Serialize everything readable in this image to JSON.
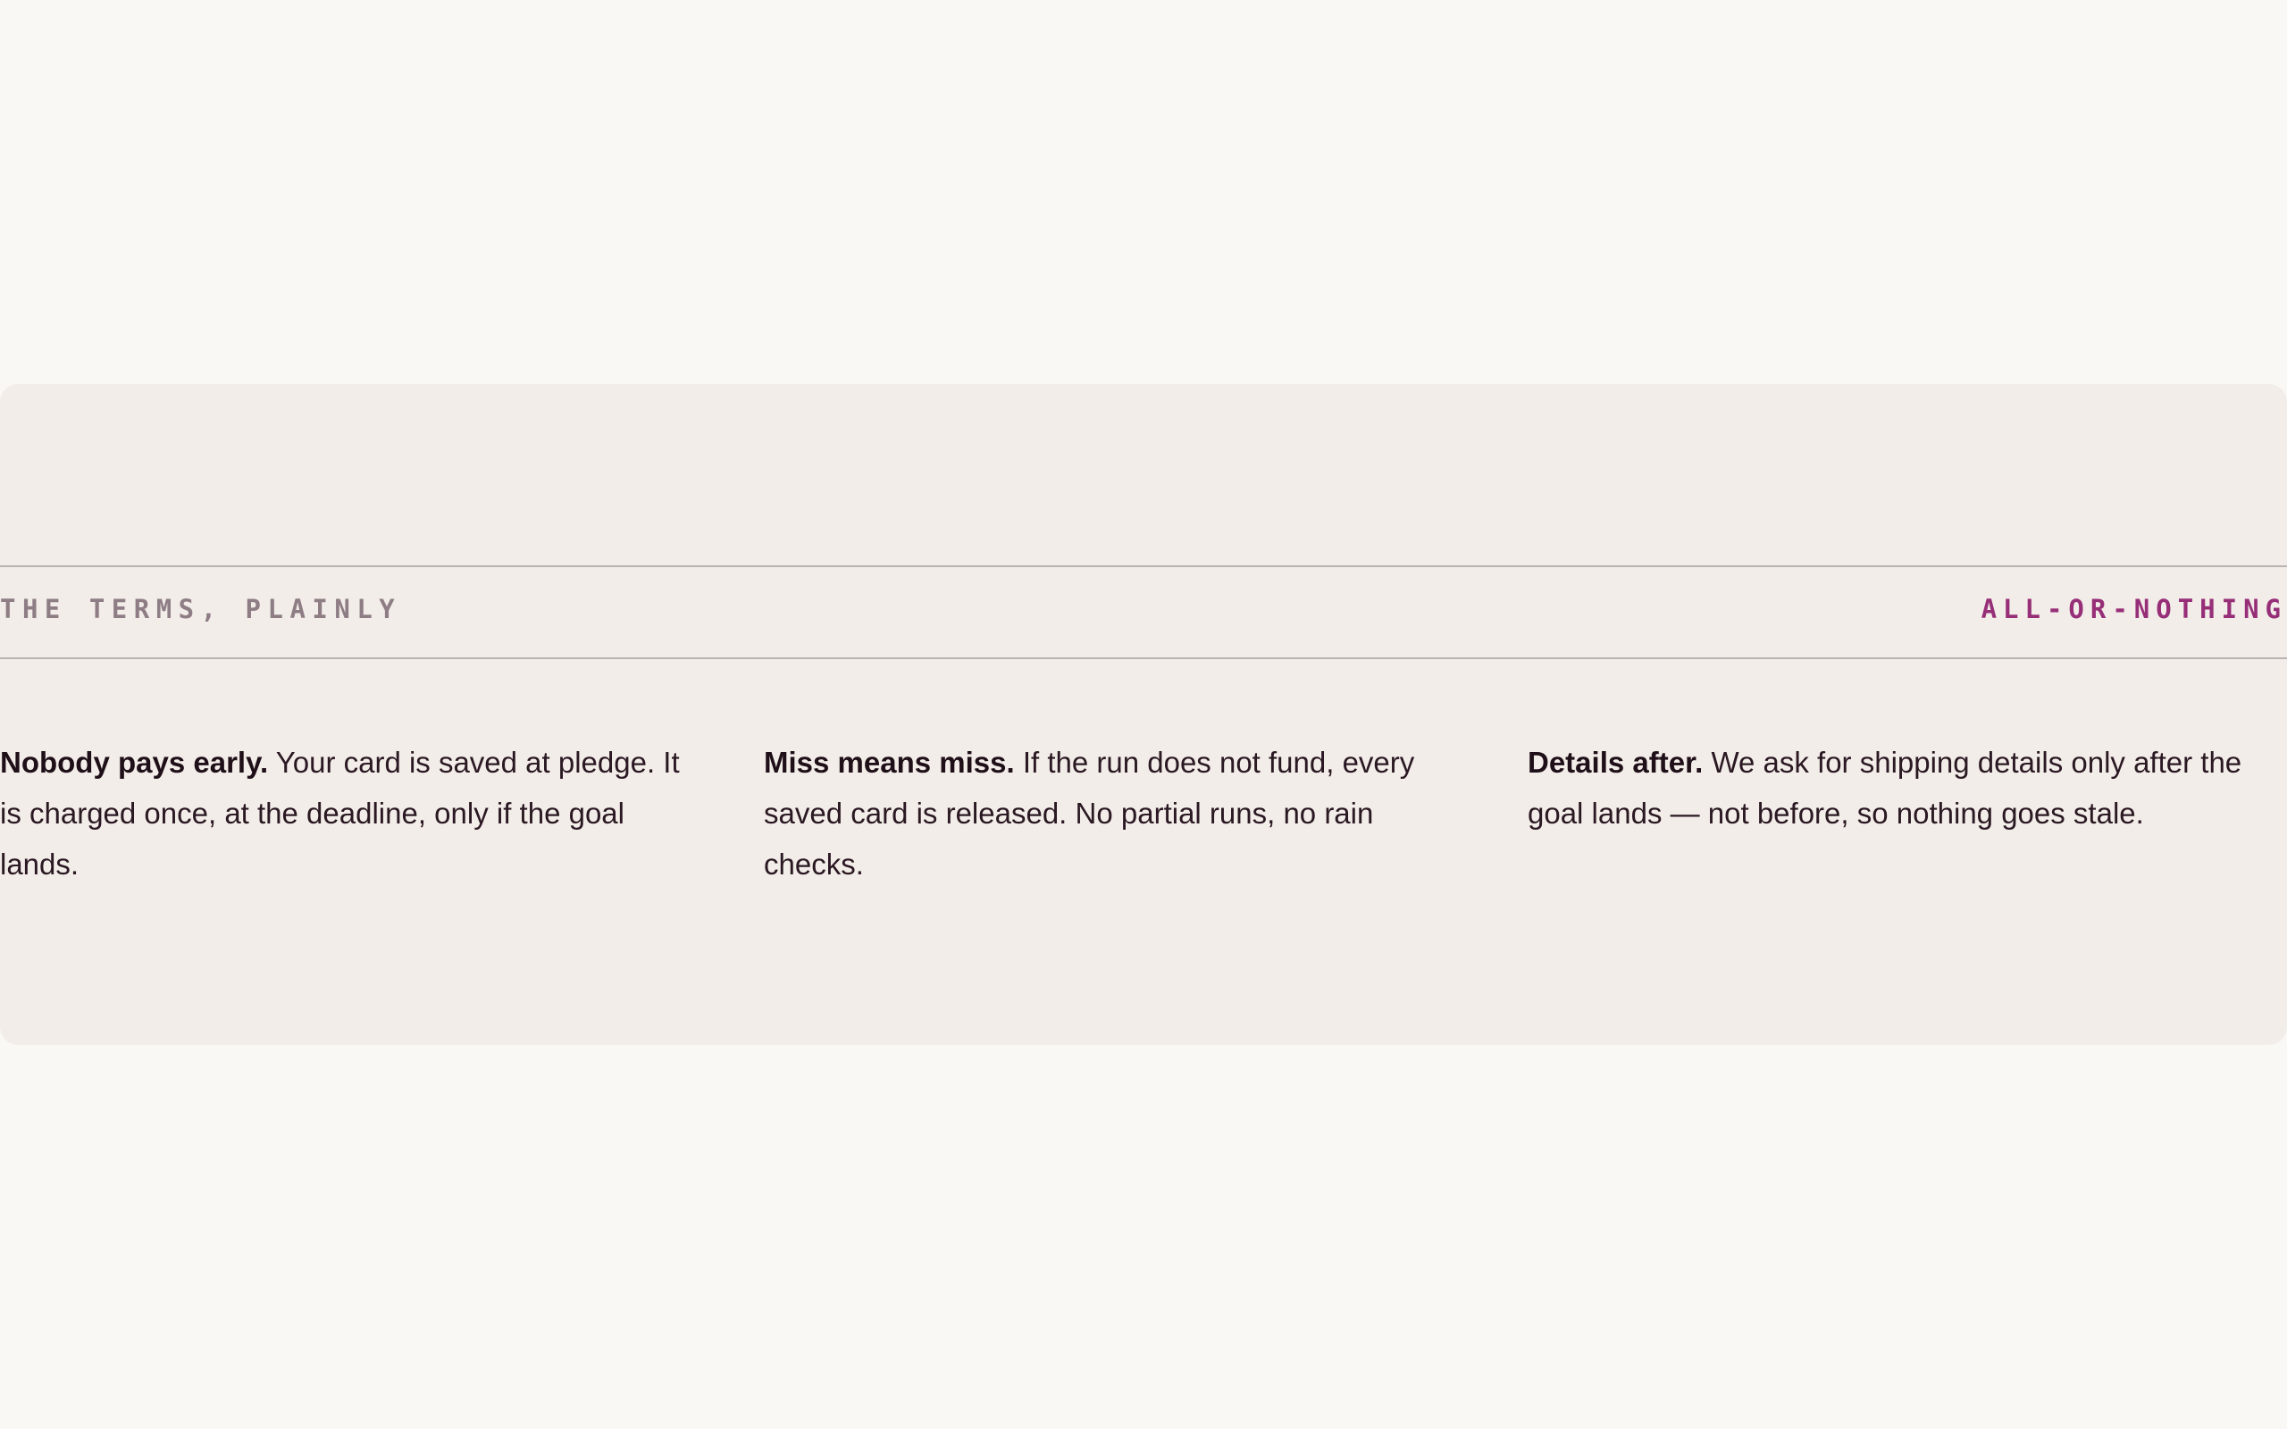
{
  "section": {
    "eyebrow": "THE TERMS, PLAINLY",
    "badge": "ALL-OR-NOTHING"
  },
  "terms": [
    {
      "heading": "Nobody pays early.",
      "body": "Your card is saved at pledge. It is charged once, at the deadline, only if the goal lands."
    },
    {
      "heading": "Miss means miss.",
      "body": "If the run does not fund, every saved card is released. No partial runs, no rain checks."
    },
    {
      "heading": "Details after.",
      "body": "We ask for shipping details only after the goal lands — not before, so nothing goes stale."
    }
  ],
  "colors": {
    "page_background": "#f9f8f4",
    "panel_background": "#f3ede9",
    "rule": "#bab3b2",
    "eyebrow_text": "#8e7d85",
    "accent": "#962f78",
    "body_text": "#2a1822"
  }
}
